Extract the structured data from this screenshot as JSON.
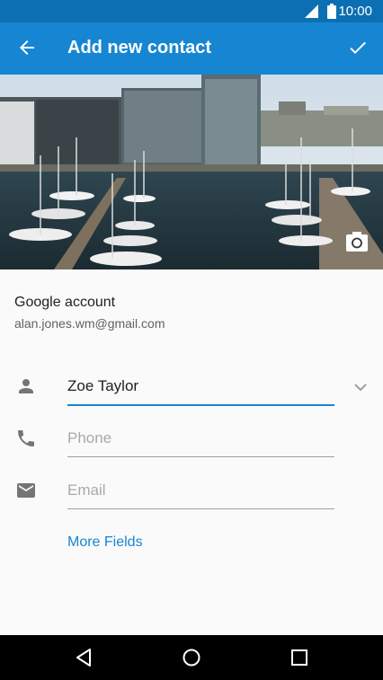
{
  "status_bar": {
    "time": "10:00"
  },
  "app_bar": {
    "title": "Add new contact"
  },
  "account": {
    "label": "Google account",
    "email": "alan.jones.wm@gmail.com"
  },
  "fields": {
    "name": {
      "value": "Zoe Taylor"
    },
    "phone": {
      "placeholder": "Phone"
    },
    "email": {
      "placeholder": "Email"
    }
  },
  "more_fields_label": "More Fields",
  "colors": {
    "primary": "#1686d3",
    "primary_dark": "#0d6fb3",
    "background": "#fafafa"
  },
  "icons": {
    "back": "arrow-back-icon",
    "save": "check-icon",
    "camera": "camera-icon",
    "person": "person-icon",
    "phone": "phone-icon",
    "email": "mail-icon",
    "expand": "chevron-down-icon",
    "nav_back": "triangle-back-icon",
    "nav_home": "circle-home-icon",
    "nav_recents": "square-recents-icon"
  }
}
